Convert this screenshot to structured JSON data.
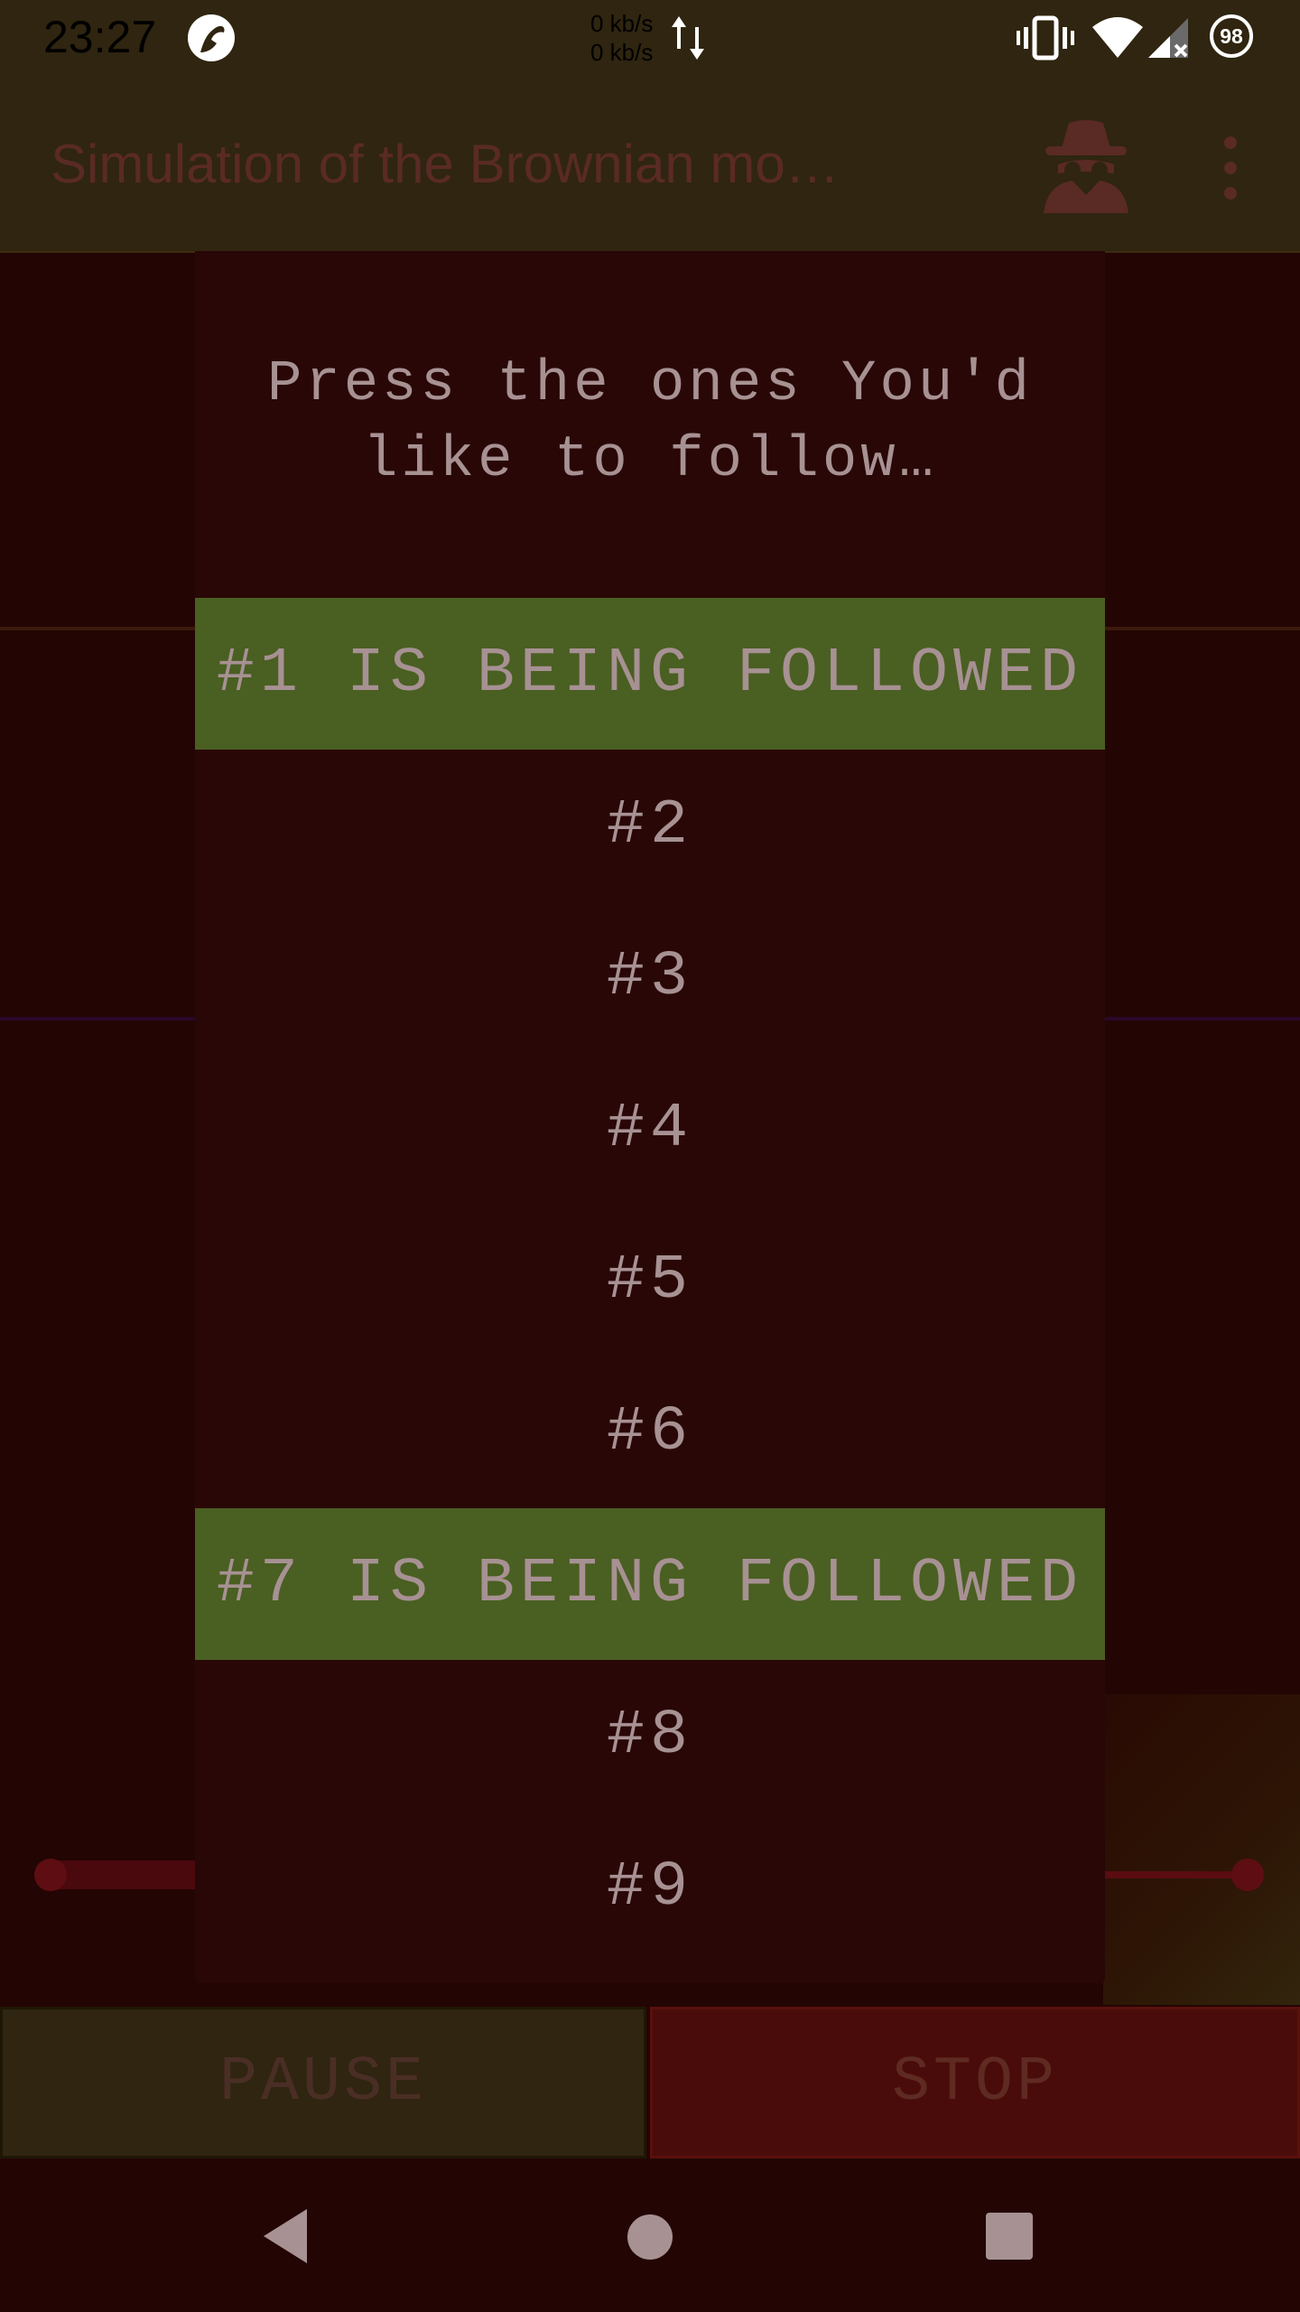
{
  "status_bar": {
    "time": "23:27",
    "net_speed_up": "0 kb/s",
    "net_speed_down": "0 kb/s",
    "battery_level": "98",
    "icons": [
      "app-notification-icon",
      "data-transfer-icon",
      "vibrate-icon",
      "wifi-icon",
      "cell-signal-icon",
      "battery-saver-icon"
    ]
  },
  "app_bar": {
    "title": "Simulation of the Brownian mo…",
    "icons": [
      "spy-icon",
      "overflow-menu-icon"
    ]
  },
  "dialog": {
    "title": "Press the ones You'd\nlike to follow…",
    "items": [
      {
        "label": "#1 IS BEING FOLLOWED",
        "followed": true
      },
      {
        "label": "#2",
        "followed": false
      },
      {
        "label": "#3",
        "followed": false
      },
      {
        "label": "#4",
        "followed": false
      },
      {
        "label": "#5",
        "followed": false
      },
      {
        "label": "#6",
        "followed": false
      },
      {
        "label": "#7 IS BEING FOLLOWED",
        "followed": true
      },
      {
        "label": "#8",
        "followed": false
      },
      {
        "label": "#9",
        "followed": false
      }
    ]
  },
  "buttons": {
    "pause_label": "PAUSE",
    "stop_label": "STOP"
  },
  "colors": {
    "dim_background": "#230503",
    "app_bar": "#2f2510",
    "dialog_background": "#290706",
    "followed_highlight": "#4a5f22",
    "dialog_text": "#a79193",
    "stop_button": "#4a0c0a"
  },
  "navigation": {
    "icons": [
      "back-icon",
      "home-icon",
      "recents-icon"
    ]
  }
}
